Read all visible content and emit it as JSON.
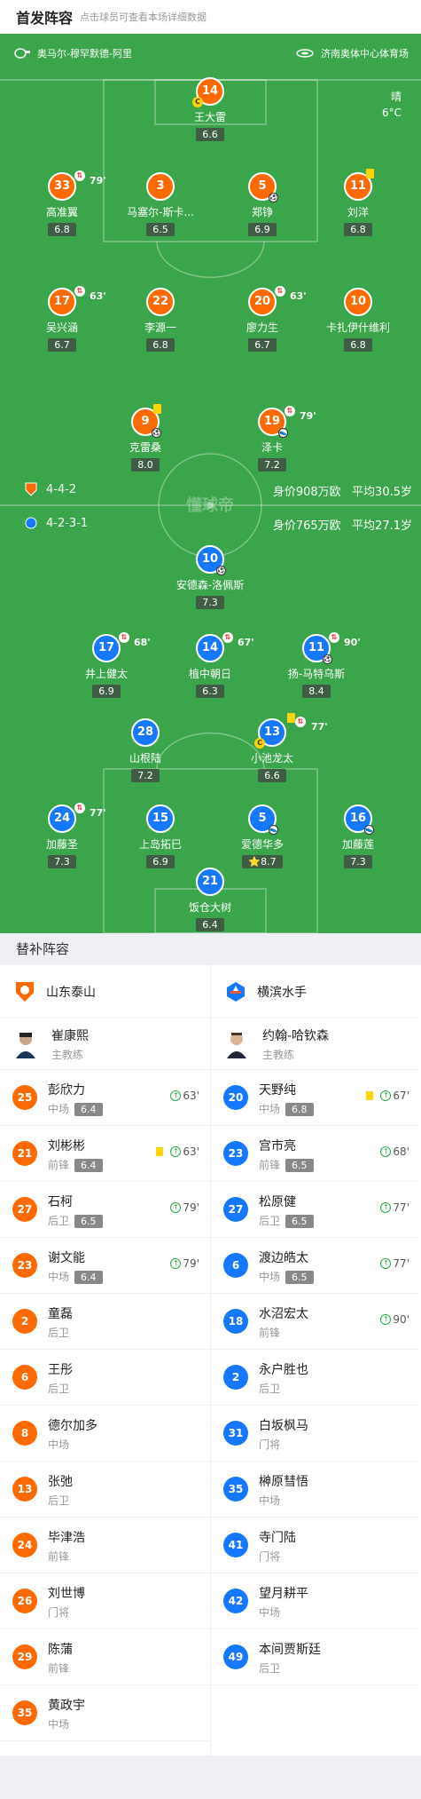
{
  "header": {
    "title": "首发阵容",
    "subtitle": "点击球员可查看本场详细数据"
  },
  "match": {
    "referee": "奥马尔-穆罕默德-阿里",
    "stadium": "济南奥体中心体育场",
    "weather": "晴",
    "temperature": "6°C",
    "watermark": "懂球帝"
  },
  "home": {
    "name": "山东泰山",
    "formation": "4-4-2",
    "value": "身价908万欧",
    "avg_age": "平均30.5岁",
    "color": "#ff6a00"
  },
  "away": {
    "name": "横滨水手",
    "formation": "4-2-3-1",
    "value": "身价765万欧",
    "avg_age": "平均27.1岁",
    "color": "#1677ff"
  },
  "home_players": [
    {
      "num": "14",
      "name": "王大雷",
      "rating": "6.6",
      "captain": true
    },
    {
      "num": "33",
      "name": "高准翼",
      "rating": "6.8",
      "sub": "79'"
    },
    {
      "num": "3",
      "name": "马塞尔-斯卡...",
      "rating": "6.5"
    },
    {
      "num": "5",
      "name": "郑铮",
      "rating": "6.9",
      "goal": true
    },
    {
      "num": "11",
      "name": "刘洋",
      "rating": "6.8",
      "yellow": true
    },
    {
      "num": "17",
      "name": "吴兴涵",
      "rating": "6.7",
      "sub": "63'"
    },
    {
      "num": "22",
      "name": "李源一",
      "rating": "6.8"
    },
    {
      "num": "20",
      "name": "廖力生",
      "rating": "6.7",
      "sub": "63'"
    },
    {
      "num": "10",
      "name": "卡扎伊什维利",
      "rating": "6.8"
    },
    {
      "num": "9",
      "name": "克雷桑",
      "rating": "8.0",
      "yellow": true,
      "goal": true
    },
    {
      "num": "19",
      "name": "泽卡",
      "rating": "7.2",
      "sub": "79'",
      "assist": true
    }
  ],
  "away_players": [
    {
      "num": "10",
      "name": "安德森-洛佩斯",
      "rating": "7.3",
      "goal": true
    },
    {
      "num": "17",
      "name": "井上健太",
      "rating": "6.9",
      "sub": "68'"
    },
    {
      "num": "14",
      "name": "植中朝日",
      "rating": "6.3",
      "sub": "67'"
    },
    {
      "num": "11",
      "name": "扬-马特乌斯",
      "rating": "8.4",
      "sub": "90'",
      "goal": true
    },
    {
      "num": "28",
      "name": "山根陆",
      "rating": "7.2"
    },
    {
      "num": "13",
      "name": "小池龙太",
      "rating": "6.6",
      "sub": "77'",
      "yellow": true,
      "captain": true
    },
    {
      "num": "24",
      "name": "加藤圣",
      "rating": "7.3",
      "sub": "77'"
    },
    {
      "num": "15",
      "name": "上岛拓巳",
      "rating": "6.9"
    },
    {
      "num": "5",
      "name": "爱德华多",
      "rating": "8.7",
      "mvp": true,
      "assist": true
    },
    {
      "num": "16",
      "name": "加藤莲",
      "rating": "7.3",
      "assist": true
    },
    {
      "num": "21",
      "name": "饭仓大树",
      "rating": "6.4"
    }
  ],
  "subs_title": "替补阵容",
  "home_coach": {
    "name": "崔康熙",
    "role": "主教练"
  },
  "away_coach": {
    "name": "约翰-哈钦森",
    "role": "主教练"
  },
  "home_subs": [
    {
      "num": "25",
      "name": "彭欣力",
      "pos": "中场",
      "rating": "6.4",
      "in": "63'"
    },
    {
      "num": "21",
      "name": "刘彬彬",
      "pos": "前锋",
      "rating": "6.4",
      "in": "63'",
      "yellow": true
    },
    {
      "num": "27",
      "name": "石柯",
      "pos": "后卫",
      "rating": "6.5",
      "in": "79'"
    },
    {
      "num": "23",
      "name": "谢文能",
      "pos": "中场",
      "rating": "6.4",
      "in": "79'"
    },
    {
      "num": "2",
      "name": "童磊",
      "pos": "后卫"
    },
    {
      "num": "6",
      "name": "王彤",
      "pos": "后卫"
    },
    {
      "num": "8",
      "name": "德尔加多",
      "pos": "中场"
    },
    {
      "num": "13",
      "name": "张弛",
      "pos": "后卫"
    },
    {
      "num": "24",
      "name": "毕津浩",
      "pos": "前锋"
    },
    {
      "num": "26",
      "name": "刘世博",
      "pos": "门将"
    },
    {
      "num": "29",
      "name": "陈蒲",
      "pos": "前锋"
    },
    {
      "num": "35",
      "name": "黄政宇",
      "pos": "中场"
    }
  ],
  "away_subs": [
    {
      "num": "20",
      "name": "天野纯",
      "pos": "中场",
      "rating": "6.8",
      "in": "67'",
      "yellow": true
    },
    {
      "num": "23",
      "name": "宫市亮",
      "pos": "前锋",
      "rating": "6.5",
      "in": "68'"
    },
    {
      "num": "27",
      "name": "松原健",
      "pos": "后卫",
      "rating": "6.5",
      "in": "77'"
    },
    {
      "num": "6",
      "name": "渡边皓太",
      "pos": "中场",
      "rating": "6.5",
      "in": "77'"
    },
    {
      "num": "18",
      "name": "水沼宏太",
      "pos": "前锋",
      "in": "90'"
    },
    {
      "num": "2",
      "name": "永户胜也",
      "pos": "后卫"
    },
    {
      "num": "31",
      "name": "白坂枫马",
      "pos": "门将"
    },
    {
      "num": "35",
      "name": "榊原彗悟",
      "pos": "中场"
    },
    {
      "num": "41",
      "name": "寺门陆",
      "pos": "门将"
    },
    {
      "num": "42",
      "name": "望月耕平",
      "pos": "中场"
    },
    {
      "num": "49",
      "name": "本间贾斯廷",
      "pos": "后卫"
    }
  ]
}
